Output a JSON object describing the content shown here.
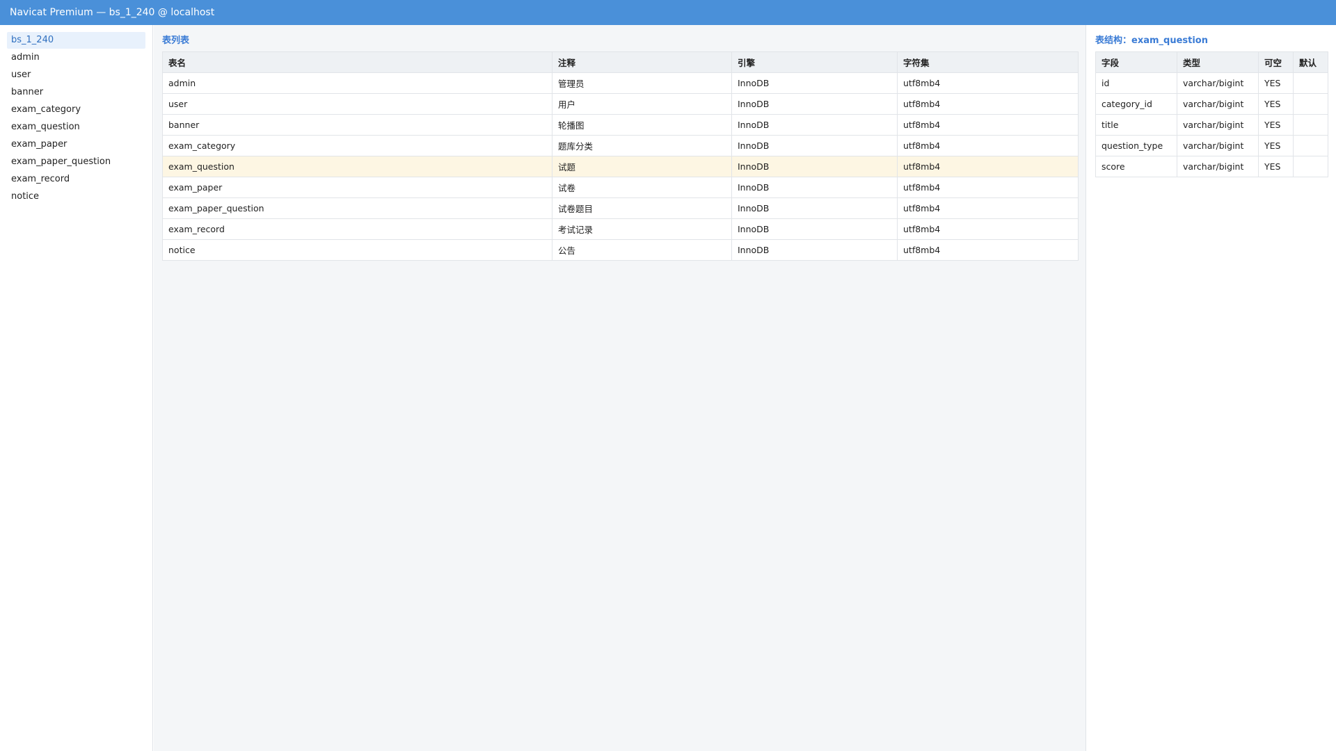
{
  "window": {
    "title": "Navicat Premium — bs_1_240 @ localhost"
  },
  "sidebar": {
    "items": [
      {
        "label": "bs_1_240",
        "active": true
      },
      {
        "label": "admin"
      },
      {
        "label": "user"
      },
      {
        "label": "banner"
      },
      {
        "label": "exam_category"
      },
      {
        "label": "exam_question"
      },
      {
        "label": "exam_paper"
      },
      {
        "label": "exam_paper_question"
      },
      {
        "label": "exam_record"
      },
      {
        "label": "notice"
      }
    ]
  },
  "table_list": {
    "title": "表列表",
    "columns": [
      "表名",
      "注释",
      "引擎",
      "字符集"
    ],
    "rows": [
      {
        "name": "admin",
        "comment": "管理员",
        "engine": "InnoDB",
        "charset": "utf8mb4"
      },
      {
        "name": "user",
        "comment": "用户",
        "engine": "InnoDB",
        "charset": "utf8mb4"
      },
      {
        "name": "banner",
        "comment": "轮播图",
        "engine": "InnoDB",
        "charset": "utf8mb4"
      },
      {
        "name": "exam_category",
        "comment": "题库分类",
        "engine": "InnoDB",
        "charset": "utf8mb4"
      },
      {
        "name": "exam_question",
        "comment": "试题",
        "engine": "InnoDB",
        "charset": "utf8mb4",
        "selected": true
      },
      {
        "name": "exam_paper",
        "comment": "试卷",
        "engine": "InnoDB",
        "charset": "utf8mb4"
      },
      {
        "name": "exam_paper_question",
        "comment": "试卷题目",
        "engine": "InnoDB",
        "charset": "utf8mb4"
      },
      {
        "name": "exam_record",
        "comment": "考试记录",
        "engine": "InnoDB",
        "charset": "utf8mb4"
      },
      {
        "name": "notice",
        "comment": "公告",
        "engine": "InnoDB",
        "charset": "utf8mb4"
      }
    ]
  },
  "structure": {
    "title": "表结构：exam_question",
    "columns": [
      "字段",
      "类型",
      "可空",
      "默认"
    ],
    "rows": [
      {
        "field": "id",
        "type": "varchar/bigint",
        "nullable": "YES",
        "default": ""
      },
      {
        "field": "category_id",
        "type": "varchar/bigint",
        "nullable": "YES",
        "default": ""
      },
      {
        "field": "title",
        "type": "varchar/bigint",
        "nullable": "YES",
        "default": ""
      },
      {
        "field": "question_type",
        "type": "varchar/bigint",
        "nullable": "YES",
        "default": ""
      },
      {
        "field": "score",
        "type": "varchar/bigint",
        "nullable": "YES",
        "default": ""
      }
    ]
  },
  "colors": {
    "titlebar": "#4a90d9",
    "accent": "#3a7bd5",
    "selected_row": "#fdf6e3",
    "sidebar_active": "#e8f1fc"
  }
}
